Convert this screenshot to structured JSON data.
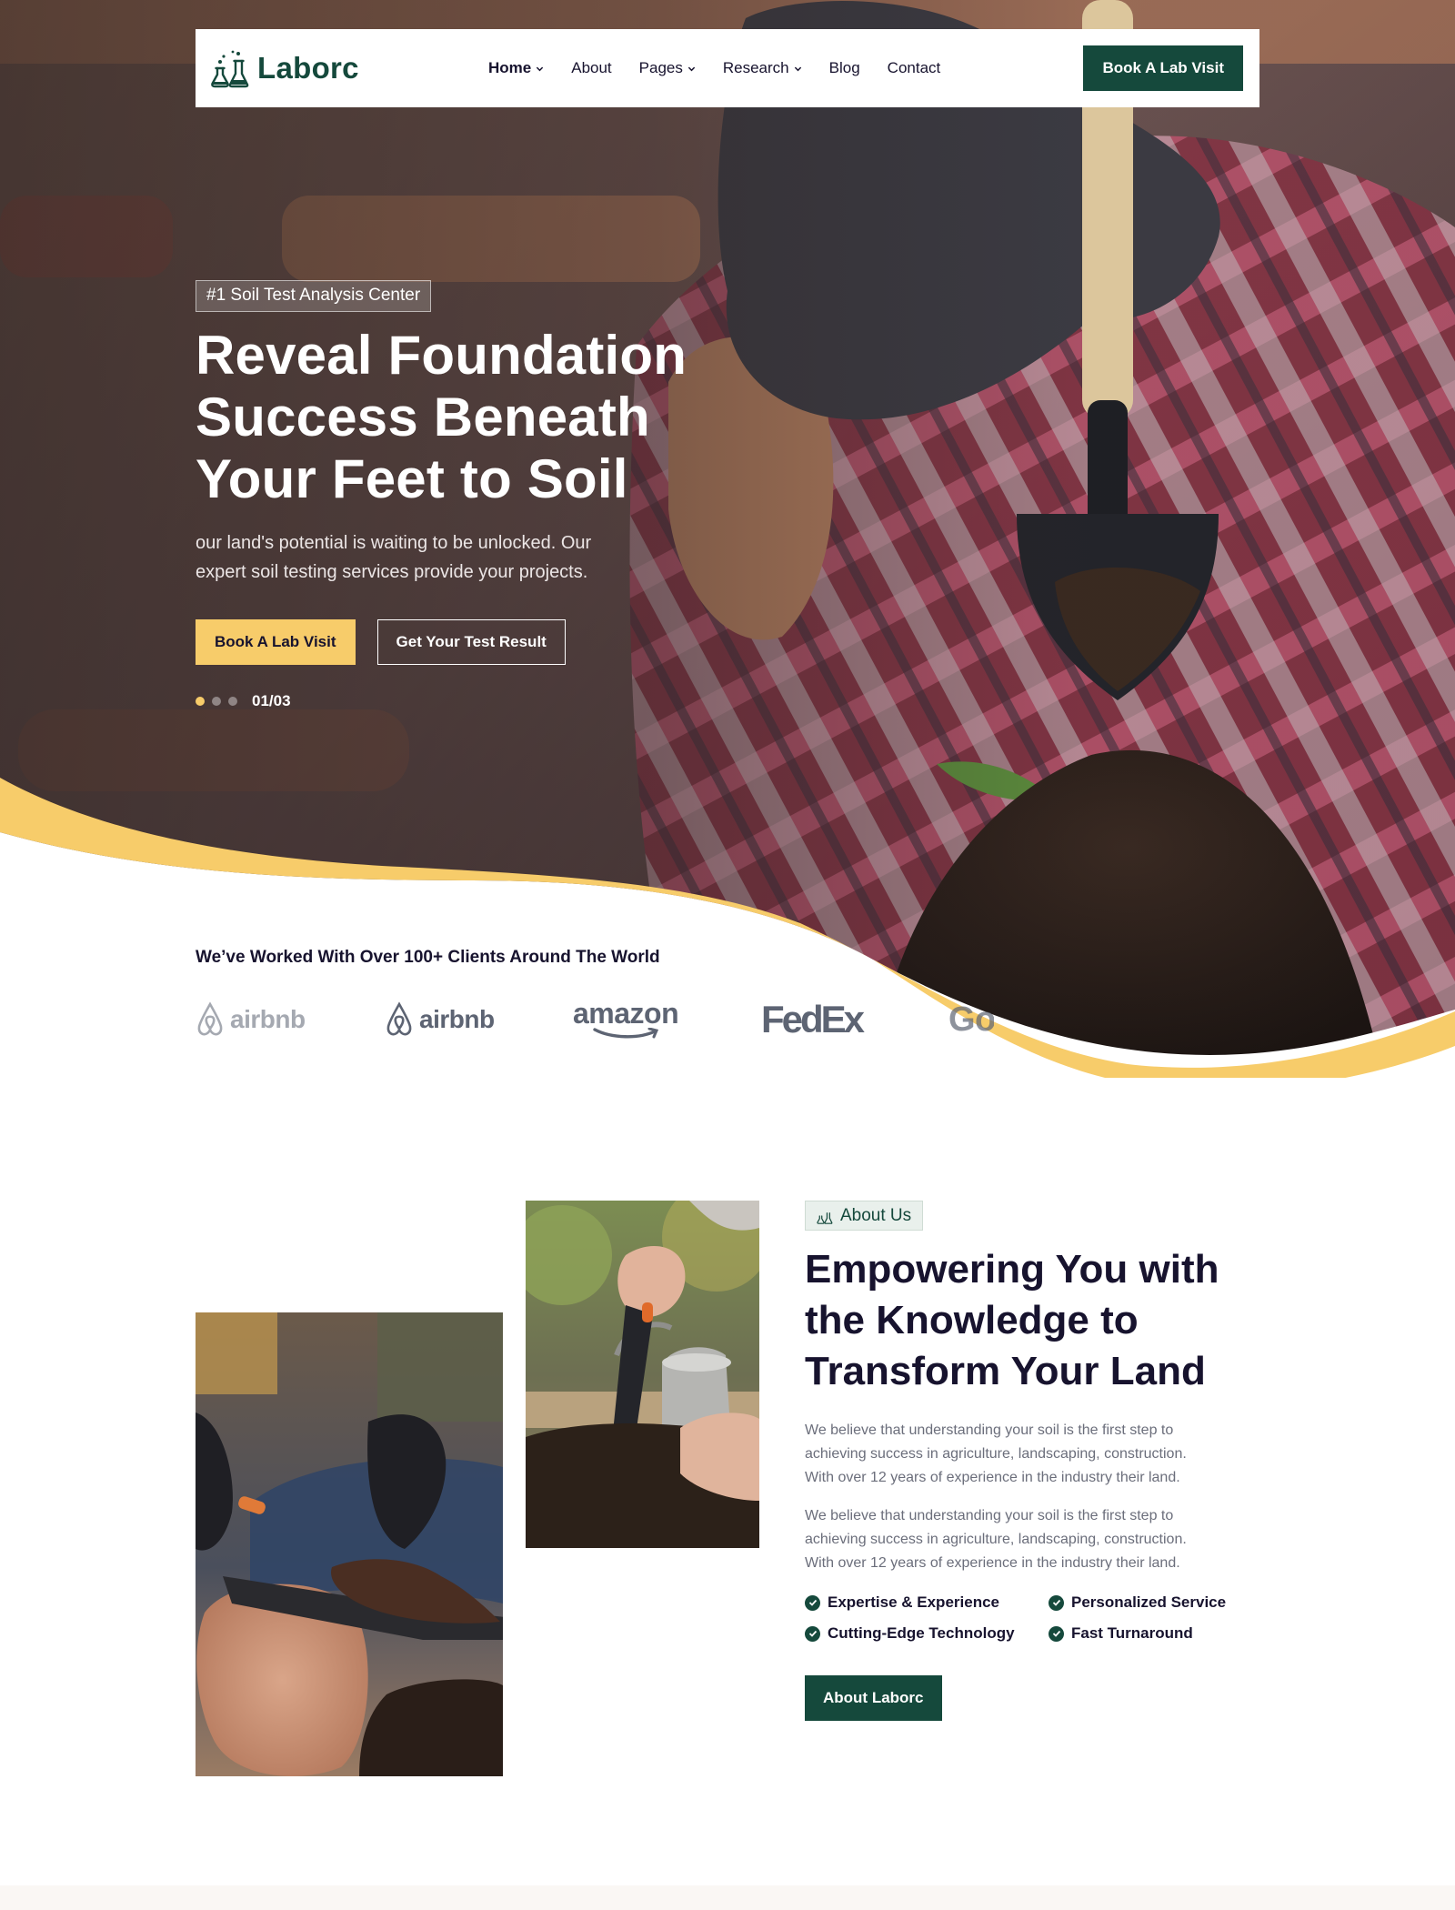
{
  "nav": {
    "brand": "Laborc",
    "menu": [
      {
        "label": "Home",
        "dropdown": true,
        "active": true
      },
      {
        "label": "About",
        "dropdown": false
      },
      {
        "label": "Pages",
        "dropdown": true
      },
      {
        "label": "Research",
        "dropdown": true
      },
      {
        "label": "Blog",
        "dropdown": false
      },
      {
        "label": "Contact",
        "dropdown": false
      }
    ],
    "cta": "Book A Lab Visit"
  },
  "hero": {
    "badge": "#1 Soil Test Analysis Center",
    "title_lines": [
      "Reveal Foundation",
      "Success Beneath",
      "Your Feet to Soil"
    ],
    "description_lines": [
      "our land's potential is waiting to be unlocked. Our",
      "expert soil testing services provide your projects."
    ],
    "primary_button": "Book A Lab Visit",
    "secondary_button": "Get Your Test Result",
    "slide_indicator": "01/03",
    "slides_total": 3,
    "active_slide": 1
  },
  "clients": {
    "title": "We’ve Worked With Over 100+ Clients Around The World",
    "logos": [
      {
        "name": "airbnb",
        "icon": "airbnb-icon"
      },
      {
        "name": "airbnb",
        "icon": "airbnb-icon"
      },
      {
        "name": "amazon",
        "icon": "amazon-smile-icon"
      },
      {
        "name": "FedEx",
        "icon": "fedex-logo"
      },
      {
        "name": "Go",
        "icon": "google-logo"
      }
    ]
  },
  "about": {
    "tag": "About Us",
    "title_lines": [
      "Empowering You with",
      "the Knowledge to",
      "Transform Your Land"
    ],
    "paragraphs": [
      [
        "We believe that understanding your soil is the first step to",
        "achieving success in agriculture, landscaping,  construction.",
        "With over 12 years of experience in the industry their land."
      ],
      [
        "We believe that understanding your soil is the first step to",
        "achieving success in agriculture, landscaping,  construction.",
        "With over 12 years of experience in the industry their land."
      ]
    ],
    "features": [
      "Expertise & Experience",
      "Personalized Service",
      "Cutting-Edge Technology",
      "Fast Turnaround"
    ],
    "button": "About Laborc"
  },
  "colors": {
    "brand_green": "#15493c",
    "accent_yellow": "#f7cc6a",
    "heading_navy": "#17132e",
    "body_grey": "#6b6e7b"
  }
}
